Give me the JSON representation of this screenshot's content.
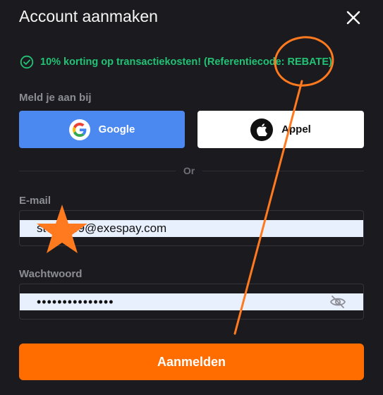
{
  "dialog": {
    "title": "Account aanmaken"
  },
  "promo": {
    "text": "10% korting op transactiekosten! (Referentiecode: REBATE)",
    "color": "#22c275"
  },
  "sso": {
    "label": "Meld je aan bij",
    "google_label": "Google",
    "apple_label": "Appel"
  },
  "divider": {
    "text": "Or"
  },
  "email": {
    "label": "E-mail",
    "value": "st****449@exespay.com"
  },
  "password": {
    "label": "Wachtwoord",
    "value": "passwordvalue12"
  },
  "submit": {
    "label": "Aanmelden",
    "color": "#ff6d00"
  },
  "icons": {
    "close": "close-icon",
    "check": "check-circle-icon",
    "google": "google-logo-icon",
    "apple": "apple-logo-icon",
    "eye": "eye-slash-icon"
  },
  "annotations": {
    "color": "#ff7a1f",
    "marks": [
      "circle",
      "arrow",
      "star"
    ]
  }
}
